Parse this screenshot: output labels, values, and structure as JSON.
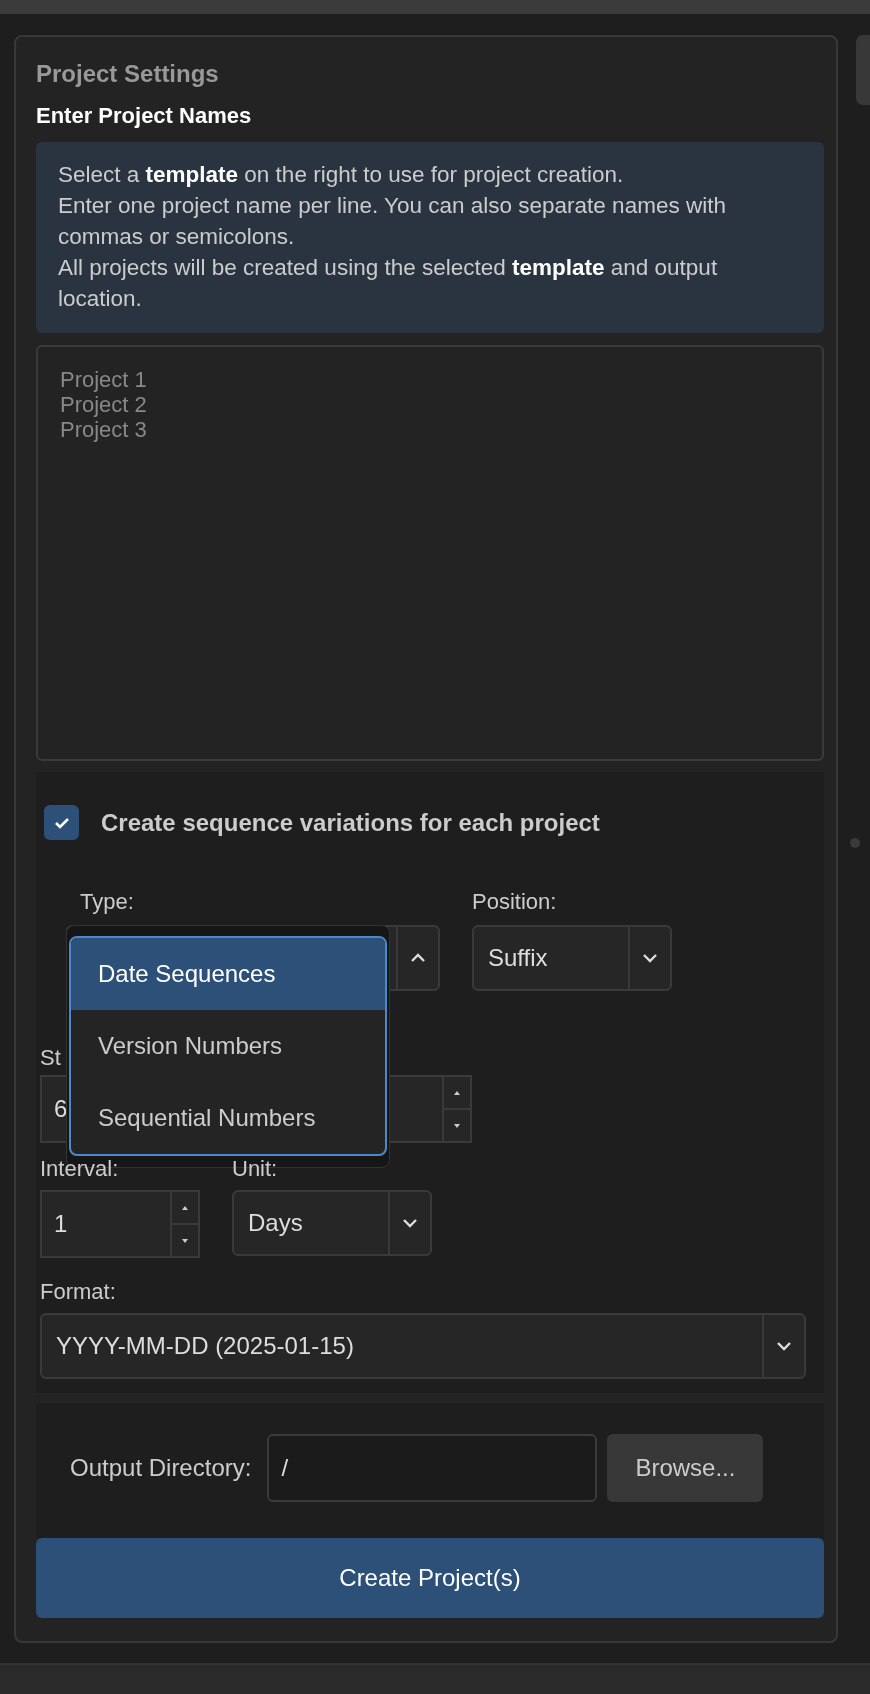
{
  "panel": {
    "title": "Project Settings",
    "subtitle": "Enter Project Names"
  },
  "info": [
    "Select a **template** on the right to use for project creation.",
    "Enter one project name per line. You can also separate names with commas or semicolons.",
    "All projects will be created using the selected **template** and output location."
  ],
  "names_field": {
    "placeholder": "Project 1\nProject 2\nProject 3"
  },
  "sequence": {
    "checked": true,
    "label": "Create sequence variations for each project",
    "type": {
      "label": "Type:",
      "expanded": true,
      "options": [
        {
          "label": "Date Sequences",
          "selected": true
        },
        {
          "label": "Version Numbers",
          "selected": false
        },
        {
          "label": "Sequential Numbers",
          "selected": false
        }
      ]
    },
    "position": {
      "label": "Position:",
      "value": "Suffix"
    },
    "start": {
      "label": "St",
      "value": "6"
    },
    "interval": {
      "label": "Interval:",
      "value": "1"
    },
    "unit": {
      "label": "Unit:",
      "value": "Days"
    },
    "format": {
      "label": "Format:",
      "value": "YYYY-MM-DD (2025-01-15)"
    }
  },
  "output": {
    "label": "Output Directory:",
    "value": "/",
    "browse": "Browse..."
  },
  "create_button": "Create Project(s)"
}
